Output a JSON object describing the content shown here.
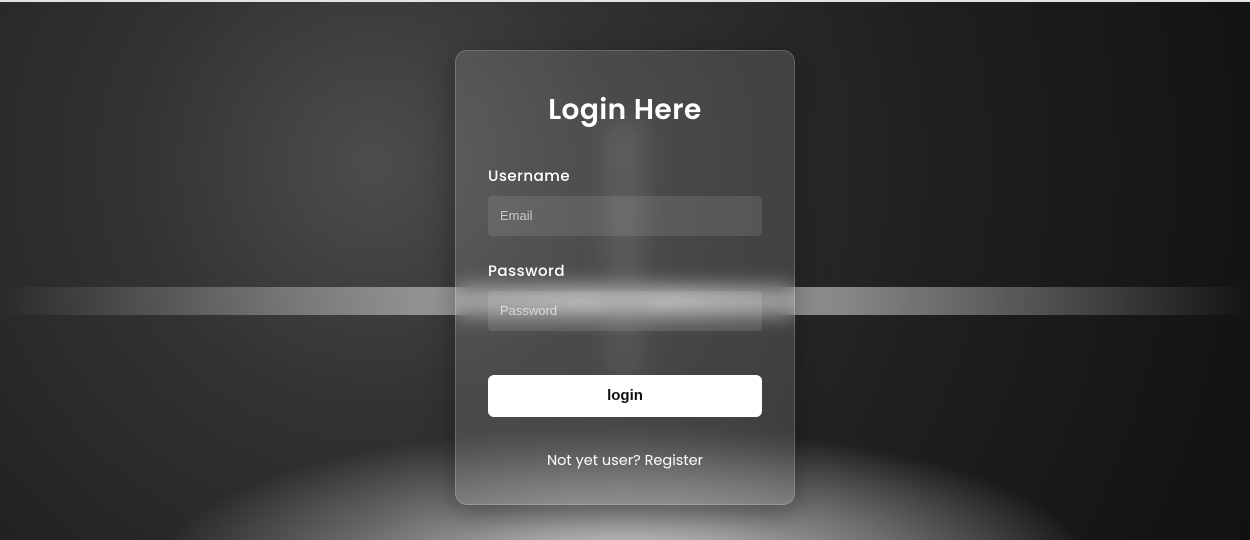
{
  "login": {
    "title": "Login Here",
    "username": {
      "label": "Username",
      "placeholder": "Email",
      "value": ""
    },
    "password": {
      "label": "Password",
      "placeholder": "Password",
      "value": ""
    },
    "submit_label": "login",
    "register": {
      "prompt": "Not yet user? ",
      "link_label": "Register"
    }
  }
}
